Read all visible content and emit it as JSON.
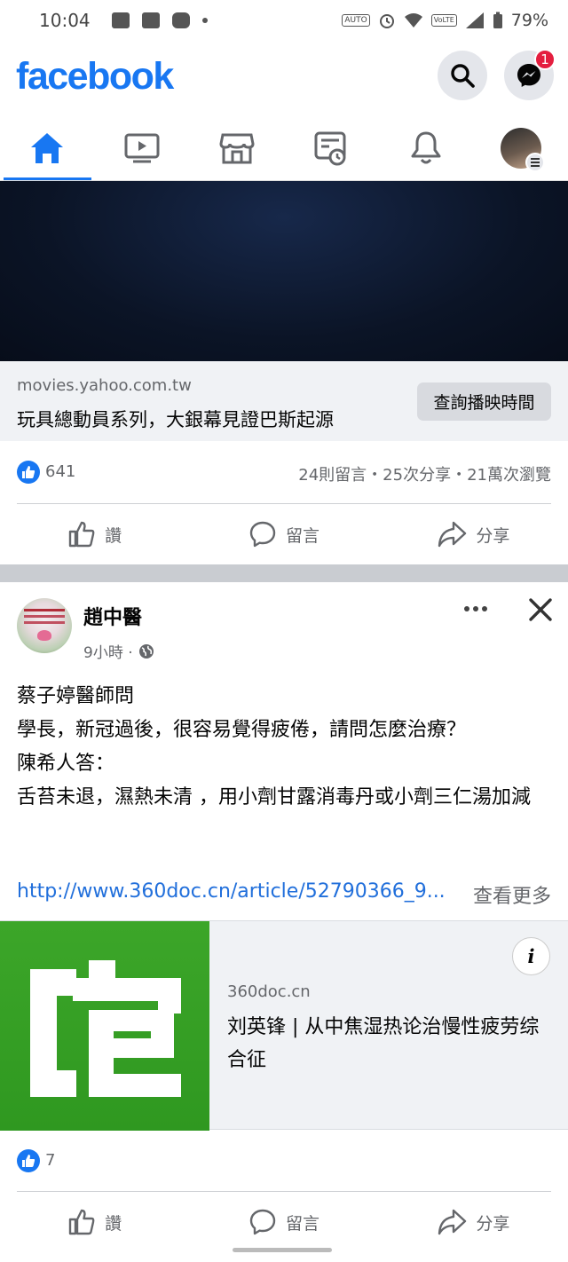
{
  "status_bar": {
    "time": "10:04",
    "battery": "79%",
    "auto_label": "AUTO",
    "volte_label": "VoLTE"
  },
  "header": {
    "logo": "facebook",
    "messenger_badge": "1"
  },
  "nav_tabs": [
    "home-icon",
    "video-icon",
    "marketplace-icon",
    "news-icon",
    "bell-icon",
    "profile-icon"
  ],
  "post1": {
    "link_domain": "movies.yahoo.com.tw",
    "link_title": "玩具總動員系列，大銀幕見證巴斯起源",
    "cta_label": "查詢播映時間",
    "like_count": "641",
    "stats": "24則留言・25次分享・21萬次瀏覽"
  },
  "actions": {
    "like": "讚",
    "comment": "留言",
    "share": "分享"
  },
  "post2": {
    "author": "趙中醫",
    "time": "9小時 ·",
    "lines": [
      "蔡子婷醫師問",
      "學長，新冠過後，很容易覺得疲倦，請問怎麼治療？",
      "陳希人答：",
      "舌苔未退，濕熱未清 ，用小劑甘露消毒丹或小劑三仁湯加減"
    ],
    "url": "http://www.360doc.cn/article/52790366_9...",
    "see_more": "查看更多",
    "preview_domain": "360doc.cn",
    "preview_title": "刘英锋 | 从中焦湿热论治慢性疲劳综合征",
    "like_count": "7"
  },
  "colors": {
    "brand": "#1877f2",
    "badge": "#e41e3f",
    "link": "#216fdb",
    "thumb_green": "#37a126"
  }
}
